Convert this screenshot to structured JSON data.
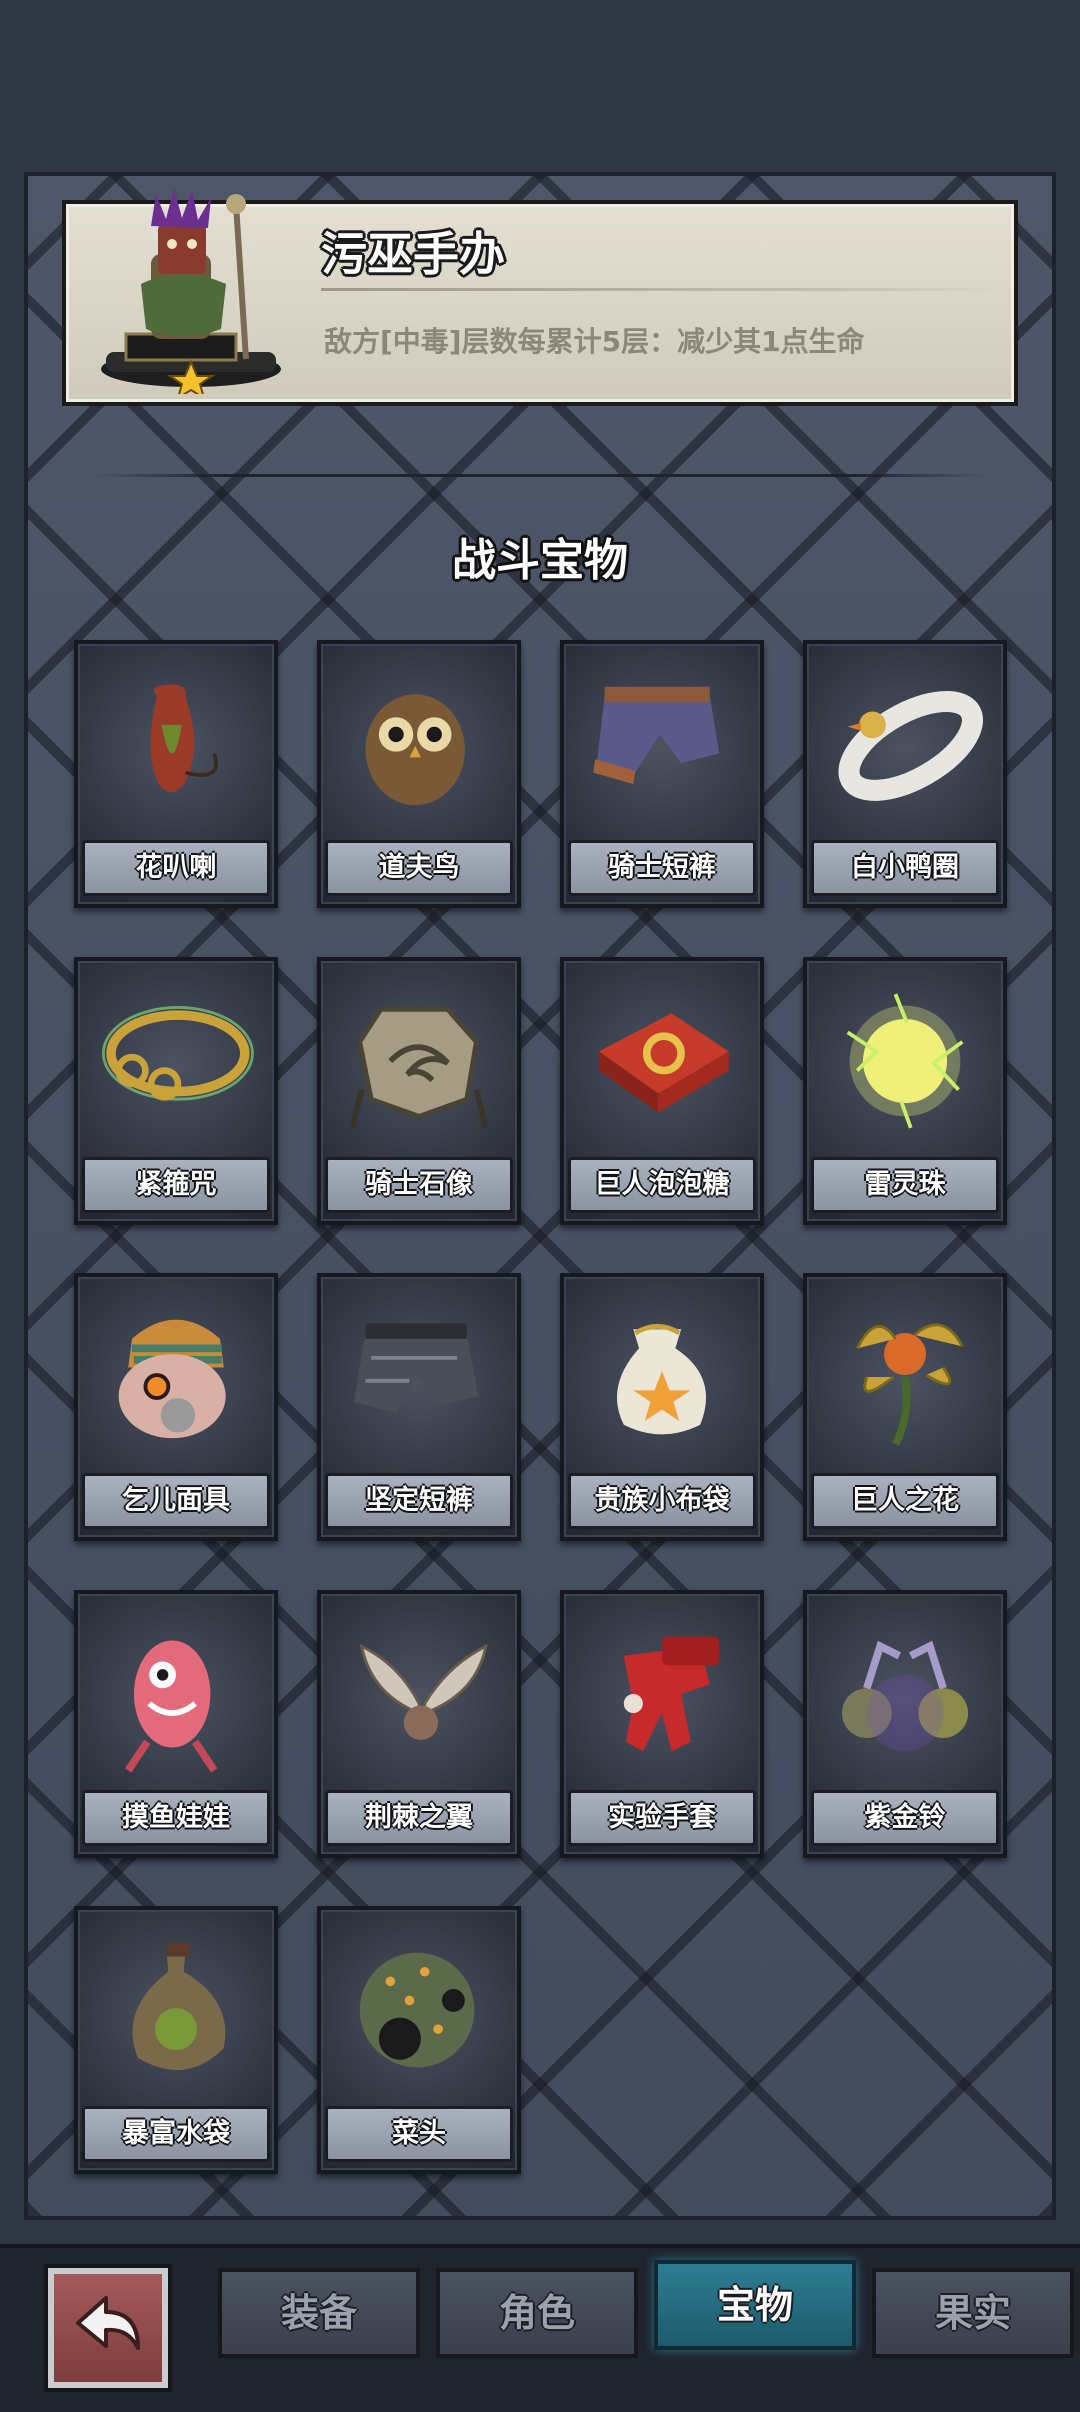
{
  "featured": {
    "title": "污巫手办",
    "description": "敌方[中毒]层数每累计5层：减少其1点生命"
  },
  "section_title": "战斗宝物",
  "items": [
    {
      "label": "花叭喇",
      "icon": "pitcher-plant-icon"
    },
    {
      "label": "道夫鸟",
      "icon": "owl-icon"
    },
    {
      "label": "骑士短裤",
      "icon": "knight-shorts-icon"
    },
    {
      "label": "白小鸭圈",
      "icon": "duck-ring-icon"
    },
    {
      "label": "紧箍咒",
      "icon": "golden-headband-icon"
    },
    {
      "label": "骑士石像",
      "icon": "stone-emblem-icon"
    },
    {
      "label": "巨人泡泡糖",
      "icon": "gum-box-icon"
    },
    {
      "label": "雷灵珠",
      "icon": "thunder-orb-icon"
    },
    {
      "label": "乞儿面具",
      "icon": "beggar-mask-icon"
    },
    {
      "label": "坚定短裤",
      "icon": "iron-shorts-icon"
    },
    {
      "label": "贵族小布袋",
      "icon": "cloth-pouch-icon"
    },
    {
      "label": "巨人之花",
      "icon": "giant-flower-icon"
    },
    {
      "label": "摸鱼娃娃",
      "icon": "pink-doll-icon"
    },
    {
      "label": "荆棘之翼",
      "icon": "thorn-wings-icon"
    },
    {
      "label": "实验手套",
      "icon": "red-glove-icon"
    },
    {
      "label": "紫金铃",
      "icon": "purple-bells-icon"
    },
    {
      "label": "暴富水袋",
      "icon": "water-pouch-icon"
    },
    {
      "label": "菜头",
      "icon": "spiky-ball-icon"
    }
  ],
  "tabs": [
    {
      "label": "装备",
      "active": false
    },
    {
      "label": "角色",
      "active": false
    },
    {
      "label": "宝物",
      "active": true
    },
    {
      "label": "果实",
      "active": false
    }
  ],
  "colors": {
    "board": "#4a5466",
    "card": "#e3e0d3",
    "active_tab": "#2d7d92",
    "back_button": "#a45a5a"
  }
}
